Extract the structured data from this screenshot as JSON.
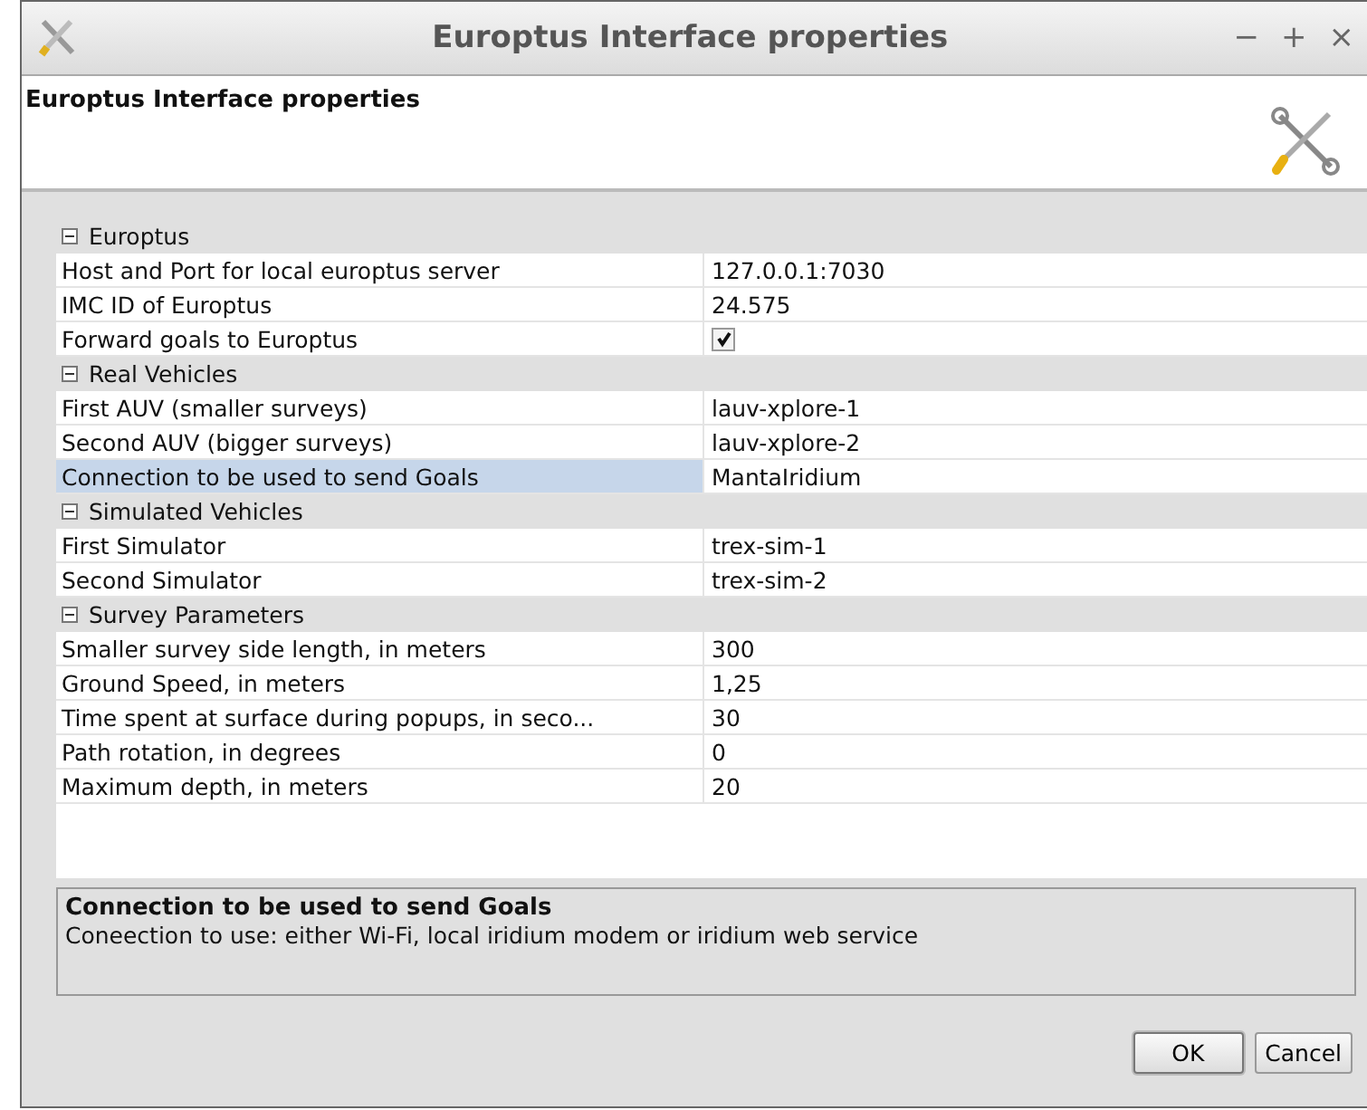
{
  "window": {
    "title": "Europtus Interface properties",
    "controls": [
      "−",
      "+",
      "×"
    ]
  },
  "header": {
    "title": "Europtus Interface properties"
  },
  "properties": [
    {
      "name": "Europtus",
      "expanded": true,
      "rows": [
        {
          "kind": "text",
          "label": "Host and Port for local europtus server",
          "value": "127.0.0.1:7030",
          "selected": false
        },
        {
          "kind": "text",
          "label": "IMC ID of Europtus",
          "value": "24.575",
          "selected": false
        },
        {
          "kind": "checkbox",
          "label": "Forward goals to Europtus",
          "checked": true,
          "selected": false
        }
      ]
    },
    {
      "name": "Real Vehicles",
      "expanded": true,
      "rows": [
        {
          "kind": "text",
          "label": "First AUV (smaller surveys)",
          "value": "lauv-xplore-1",
          "selected": false
        },
        {
          "kind": "text",
          "label": "Second AUV (bigger surveys)",
          "value": "lauv-xplore-2",
          "selected": false
        },
        {
          "kind": "text",
          "label": "Connection to be used to send Goals",
          "value": "MantaIridium",
          "selected": true
        }
      ]
    },
    {
      "name": "Simulated Vehicles",
      "expanded": true,
      "rows": [
        {
          "kind": "text",
          "label": "First Simulator",
          "value": "trex-sim-1",
          "selected": false
        },
        {
          "kind": "text",
          "label": "Second Simulator",
          "value": "trex-sim-2",
          "selected": false
        }
      ]
    },
    {
      "name": "Survey Parameters",
      "expanded": true,
      "rows": [
        {
          "kind": "text",
          "label": "Smaller survey side length, in meters",
          "value": "300",
          "selected": false
        },
        {
          "kind": "text",
          "label": "Ground Speed, in meters",
          "value": "1,25",
          "selected": false
        },
        {
          "kind": "text",
          "label": "Time spent at surface during popups, in seco...",
          "value": "30",
          "selected": false
        },
        {
          "kind": "text",
          "label": "Path rotation, in degrees",
          "value": "0",
          "selected": false
        },
        {
          "kind": "text",
          "label": "Maximum depth, in meters",
          "value": "20",
          "selected": false
        }
      ]
    }
  ],
  "description": {
    "title": "Connection to be used to send Goals",
    "text": "Coneection to use: either Wi-Fi, local iridium modem or iridium web service"
  },
  "buttons": [
    "OK",
    "Cancel"
  ]
}
